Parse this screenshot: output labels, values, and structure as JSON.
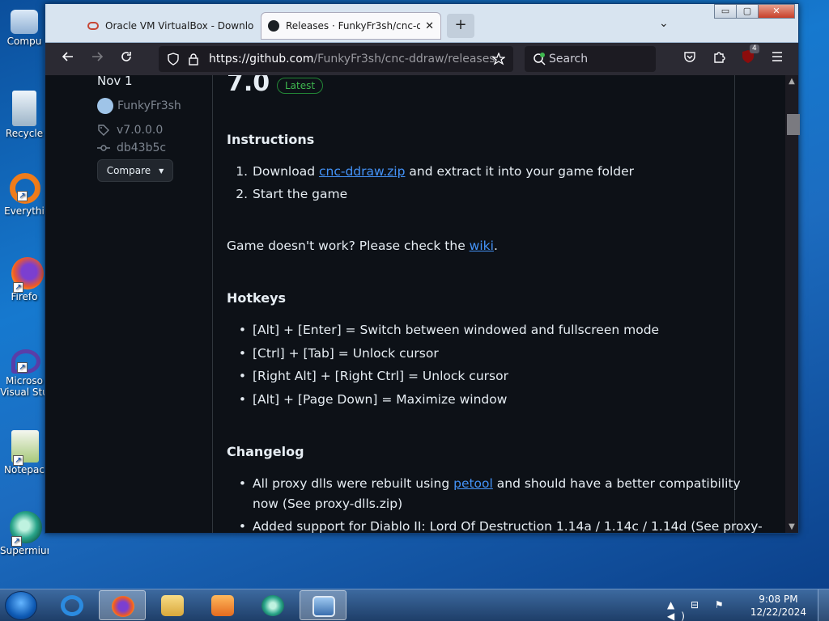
{
  "desktop": {
    "icons": [
      {
        "label": "Compu",
        "color": "#cfe3f7"
      },
      {
        "label": "Recycle",
        "color": "#d8e8f4"
      },
      {
        "label": "Everythi",
        "color": "#f07c1a"
      },
      {
        "label": "Firefo",
        "color": "#e8542a"
      },
      {
        "label": "Microso Visual Stu",
        "color": "#5a3ea8"
      },
      {
        "label": "Notepac",
        "color": "#8dbb5a"
      },
      {
        "label": "Supermium",
        "color": "#2aa58a"
      }
    ]
  },
  "browser": {
    "tabs": [
      {
        "title": "Oracle VM VirtualBox - Downlo",
        "icon": "oracle-icon",
        "close": "✕"
      },
      {
        "title": "Releases · FunkyFr3sh/cnc-ddra",
        "icon": "github-icon",
        "close": "✕"
      }
    ],
    "new_tab": "+",
    "list_tabs": "⌄",
    "url_host": "https://github.com",
    "url_path": "/FunkyFr3sh/cnc-ddraw/releases",
    "search_placeholder": "Search",
    "extension_badge": "4",
    "window_controls": {
      "minimize": "▭",
      "maximize": "▢",
      "close": "✕"
    }
  },
  "release": {
    "date": "Nov 1",
    "author": "FunkyFr3sh",
    "tag": "v7.0.0.0",
    "commit": "db43b5c",
    "compare_label": "Compare",
    "title": "7.0",
    "badge": "Latest",
    "instructions_heading": "Instructions",
    "instructions": [
      {
        "num": "1.",
        "pre": "Download ",
        "link": "cnc-ddraw.zip",
        "post": " and extract it into your game folder"
      },
      {
        "num": "2.",
        "pre": "Start the game",
        "link": "",
        "post": ""
      }
    ],
    "help_pre": "Game doesn't work? Please check the ",
    "help_link": "wiki",
    "help_post": ".",
    "hotkeys_heading": "Hotkeys",
    "hotkeys": [
      "[Alt] + [Enter] = Switch between windowed and fullscreen mode",
      "[Ctrl] + [Tab] = Unlock cursor",
      "[Right Alt] + [Right Ctrl] = Unlock cursor",
      "[Alt] + [Page Down] = Maximize window"
    ],
    "changelog_heading": "Changelog",
    "changelog": [
      {
        "pre": "All proxy dlls were rebuilt using ",
        "link": "petool",
        "post": " and should have a better compatibility",
        "line2": "now (See proxy-dlls.zip)"
      },
      {
        "pre": "Added support for Diablo II: Lord Of Destruction 1.14a / 1.14c / 1.14d (See proxy-",
        "link": "",
        "post": "",
        "line2": ""
      }
    ]
  },
  "taskbar": {
    "time": "9:08 PM",
    "date": "12/22/2024",
    "tray_glyphs": "▲ ⊟ ⚑ ◀)"
  }
}
